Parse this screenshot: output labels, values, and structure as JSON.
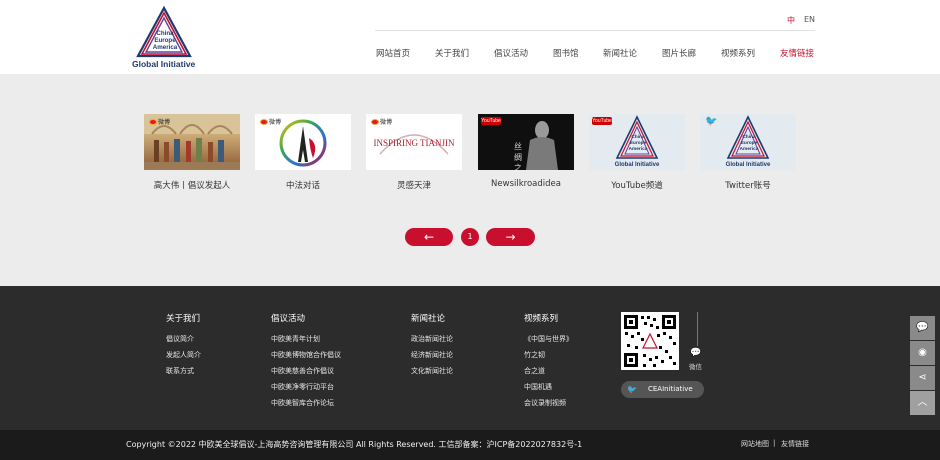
{
  "header": {
    "logo": {
      "words": [
        "China",
        "Europe",
        "America"
      ],
      "tagline": "Global Initiative"
    },
    "lang": {
      "zh": "中",
      "en": "EN"
    },
    "nav": [
      {
        "label": "网站首页"
      },
      {
        "label": "关于我们"
      },
      {
        "label": "倡议活动"
      },
      {
        "label": "图书馆"
      },
      {
        "label": "新闻社论"
      },
      {
        "label": "图片长廊"
      },
      {
        "label": "视频系列"
      },
      {
        "label": "友情链接",
        "active": true
      }
    ]
  },
  "cards": [
    {
      "caption": "高大伟丨倡议发起人",
      "badge": "微博"
    },
    {
      "caption": "中法对话",
      "badge": "微博"
    },
    {
      "caption": "灵感天津",
      "badge": "微博",
      "art": "INSPIRING TIANJIN"
    },
    {
      "caption": "Newsilkroadidea",
      "badge": "YouTube",
      "art": "丝 绸 之 路"
    },
    {
      "caption": "YouTube频道",
      "badge": "YouTube"
    },
    {
      "caption": "Twitter账号",
      "badge": "twitter-icon"
    }
  ],
  "pager": {
    "prev": "←",
    "page": "1",
    "next": "→"
  },
  "footer": {
    "columns": [
      {
        "title": "关于我们",
        "links": [
          "倡议简介",
          "发起人简介",
          "联系方式"
        ]
      },
      {
        "title": "倡议活动",
        "links": [
          "中欧美青年计划",
          "中欧美博物馆合作倡议",
          "中欧美慈善合作倡议",
          "中欧美净零行动平台",
          "中欧美智库合作论坛"
        ]
      },
      {
        "title": "新闻社论",
        "links": [
          "政治新闻社论",
          "经济新闻社论",
          "文化新闻社论"
        ]
      },
      {
        "title": "视频系列",
        "links": [
          "《中国与世界》",
          "竹之韧",
          "合之道",
          "中国机遇",
          "会议录制视频"
        ]
      }
    ],
    "wechat_label": "微信",
    "twitter_handle": "CEAInitiative"
  },
  "bottom": {
    "copyright": "Copyright ©2022 中欧美全球倡议-上海高势咨询管理有限公司 All Rights Reserved.  工信部备案：沪ICP备2022027832号-1",
    "links": [
      "网站地图",
      "|",
      "友情链接"
    ]
  },
  "side": [
    "wechat-icon",
    "weibo-icon",
    "share-icon",
    "back-to-top-icon"
  ],
  "colors": {
    "accent": "#c8102e",
    "footer_bg": "#2c2c2c",
    "bottom_bg": "#1b1b1b"
  }
}
